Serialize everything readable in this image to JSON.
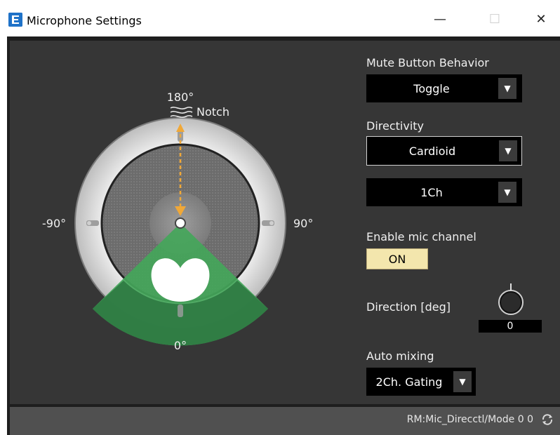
{
  "window": {
    "title": "Microphone Settings",
    "controls": {
      "minimize_icon": "—",
      "maximize_icon": "☐",
      "close_icon": "✕"
    }
  },
  "visual": {
    "labels": {
      "top_angle": "180°",
      "notch": "Notch",
      "left_angle": "-90°",
      "right_angle": "90°",
      "bottom_angle": "0°"
    }
  },
  "controls": {
    "mute": {
      "label": "Mute Button Behavior",
      "value": "Toggle"
    },
    "directivity": {
      "label": "Directivity",
      "value": "Cardioid"
    },
    "channel": {
      "value": "1Ch"
    },
    "enable_mic": {
      "label": "Enable mic channel",
      "button": "ON"
    },
    "direction": {
      "label": "Direction [deg]",
      "value": "0"
    },
    "automix": {
      "label": "Auto mixing",
      "value": "2Ch. Gating"
    }
  },
  "status": {
    "text": "RM:Mic_Direcctl/Mode 0 0"
  },
  "colors": {
    "accent_orange": "#f0a838",
    "green": "#44a65a",
    "green_dark": "#2f7b43",
    "panel": "#363636"
  }
}
